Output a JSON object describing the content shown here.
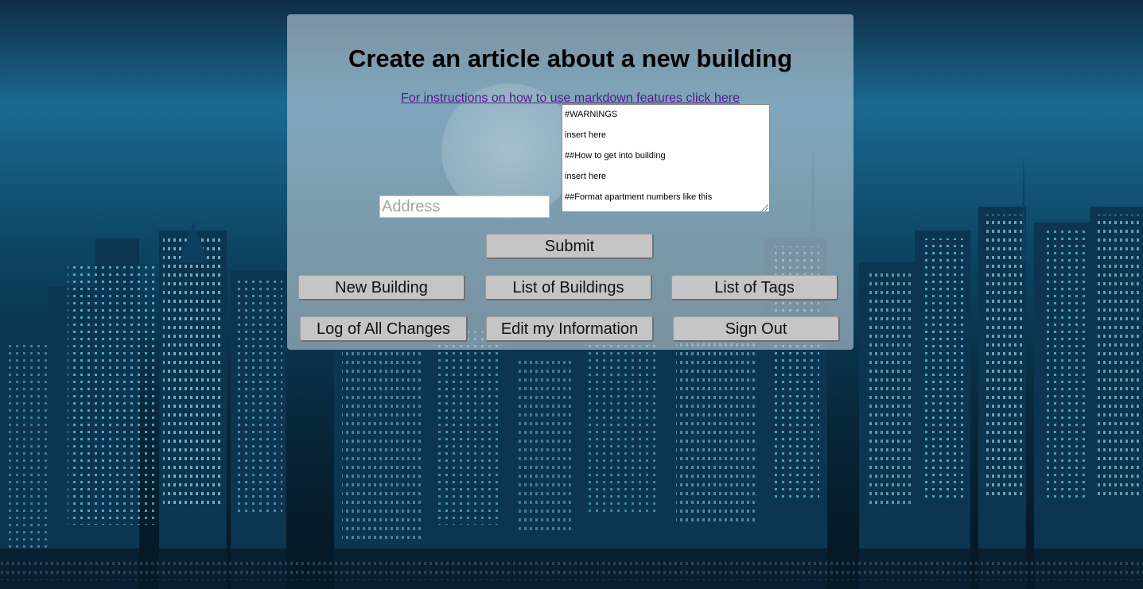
{
  "page": {
    "title": "Create an article about a new building",
    "instructions_link": "For instructions on how to use markdown features click here"
  },
  "form": {
    "address_placeholder": "Address",
    "editor_lines": [
      "#WARNINGS",
      "insert here",
      "##How to get into building",
      "insert here",
      "##Format apartment numbers like this"
    ],
    "submit_label": "Submit"
  },
  "nav": {
    "new_building": "New Building",
    "list_buildings": "List of Buildings",
    "list_tags": "List of Tags",
    "log_changes": "Log of All Changes",
    "edit_info": "Edit my Information",
    "sign_out": "Sign Out"
  },
  "colors": {
    "panel": "#becdd6",
    "button": "#c5c5c5",
    "link": "#52198b"
  }
}
